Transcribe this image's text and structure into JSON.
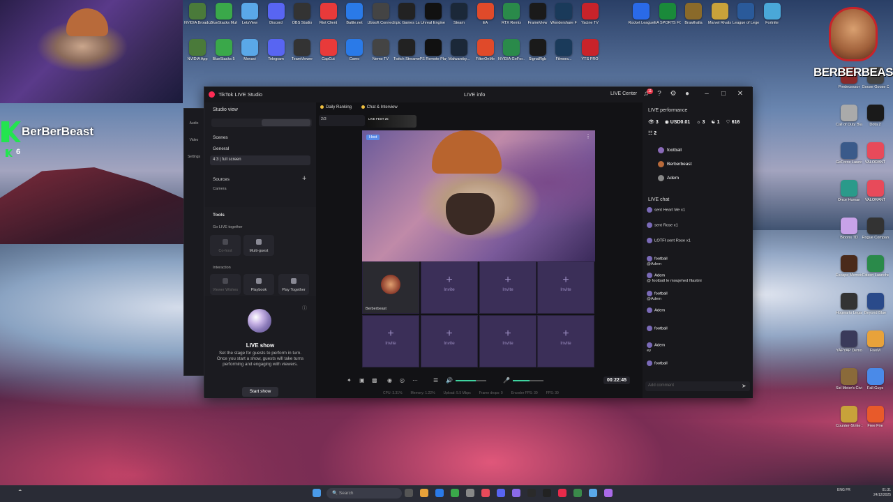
{
  "desktop": {
    "top_icons": [
      "NVIDIA Broadcast",
      "BlueStacks Multi-Insta...",
      "LetsView",
      "Discord",
      "OBS Studio",
      "Riot Client",
      "Battle.net",
      "Ubisoft Connect",
      "Epic Games Launcher",
      "Unreal Engine",
      "Steam",
      "EA",
      "RTX Remix",
      "FrameView",
      "Wondershare Filmora 13",
      "Yacine TV",
      "NVIDIA App",
      "BlueStacks 5",
      "Movavi",
      "Telegram",
      "TeamViewer",
      "CapCut",
      "Camo",
      "Nemo TV",
      "Twitch Streamer",
      "PS Remote Play",
      "Malwareby...",
      "FilterOnMe",
      "NVIDIA GeFor...",
      "SignalRgb",
      "Filmora...",
      "YTS PRO"
    ],
    "right_icons": [
      "Rocket League",
      "EA SPORTS FC 25",
      "Brawlhalla",
      "Marvel Rivals",
      "League of Legends",
      "Fortnite",
      "Predecessor",
      "Goose Goose Duck",
      "Call of Duty Black Ops...",
      "Dota 2",
      "GeForce Launcher",
      "VALORANT",
      "Once Human",
      "VALORANT",
      "Bloons TD",
      "Rogue Company",
      "Escape Memoirs",
      "Citizen Launcher",
      "Hogwarts Legacy",
      "Beyond Blue",
      "YAPYAP Demo",
      "FiveM",
      "Sid Meier's Civilization VI",
      "Fall Guys",
      "Counter-Strike 2",
      "Free Fire"
    ],
    "logo_text": "BERBERBEAST",
    "channel_name": "BerBerBeast",
    "viewer_count": "6"
  },
  "window": {
    "app_title": "TikTok LIVE Studio",
    "live_info": "LIVE info",
    "live_center": "LIVE Center",
    "notif_count": "11"
  },
  "studio": {
    "view_label": "Studio view",
    "scenes": "Scenes",
    "general": "General",
    "scene_item": "4:3 | full screen",
    "sources": "Sources",
    "camera": "Camera",
    "tools": "Tools",
    "go_live_together": "Go LIVE together",
    "cohost": "Co-host",
    "multiguest": "Multi-guest",
    "interaction": "Interaction",
    "viewer_wishes": "Viewer Wishes",
    "playbook": "Playbook",
    "play_together": "Play Together",
    "live_show_title": "LIVE show",
    "live_show_desc": "Set the stage for guests to perform in turn. Once you start a show, guests will take turns performing and engaging with viewers.",
    "start_show": "Start show"
  },
  "rail": [
    "Audio",
    "Video",
    "Settings"
  ],
  "main": {
    "tab_daily_ranking": "Daily Ranking",
    "tab_chat": "Chat & Interview",
    "rank_value": "2/3",
    "fest": "LIVE FEST 25",
    "host_tag": "Host",
    "guest_name": "Berberbeast",
    "invite": "Invite",
    "timer": "00:22:45",
    "volume_level": 0.65,
    "mic_level": 0.55,
    "stats": [
      "CPU: 3.31%",
      "Memory: 1.22%",
      "Upload: 5.5 Mbps",
      "Frame drops: 0",
      "Encoder FPS: 30",
      "FPS: 30"
    ]
  },
  "right": {
    "perf_title": "LIVE performance",
    "perf": [
      "3",
      "USD0.01",
      "3",
      "1",
      "616"
    ],
    "perf2": "2",
    "ranking": [
      "football",
      "Berberbeast",
      "Adem"
    ],
    "chat_title": "LIVE chat",
    "chat": [
      {
        "user": "",
        "text": "sent Heart Me",
        "qty": "x1"
      },
      {
        "user": "",
        "text": "sent Rose",
        "qty": "x1"
      },
      {
        "user": "LOTFI",
        "text": "sent Rose",
        "qty": "x1"
      },
      {
        "user": "football",
        "text": "@Adem"
      },
      {
        "user": "Adem",
        "text": "@ football le moujehed filastini"
      },
      {
        "user": "football",
        "text": "@Adem"
      },
      {
        "user": "Adem",
        "text": ""
      },
      {
        "user": "football",
        "text": ""
      },
      {
        "user": "Adem",
        "text": "ey"
      },
      {
        "user": "football",
        "text": ""
      }
    ],
    "add_comment": "Add comment"
  },
  "taskbar": {
    "search": "Search",
    "lang": "ENG FR",
    "time": "01:31",
    "date": "24/12/2025"
  }
}
